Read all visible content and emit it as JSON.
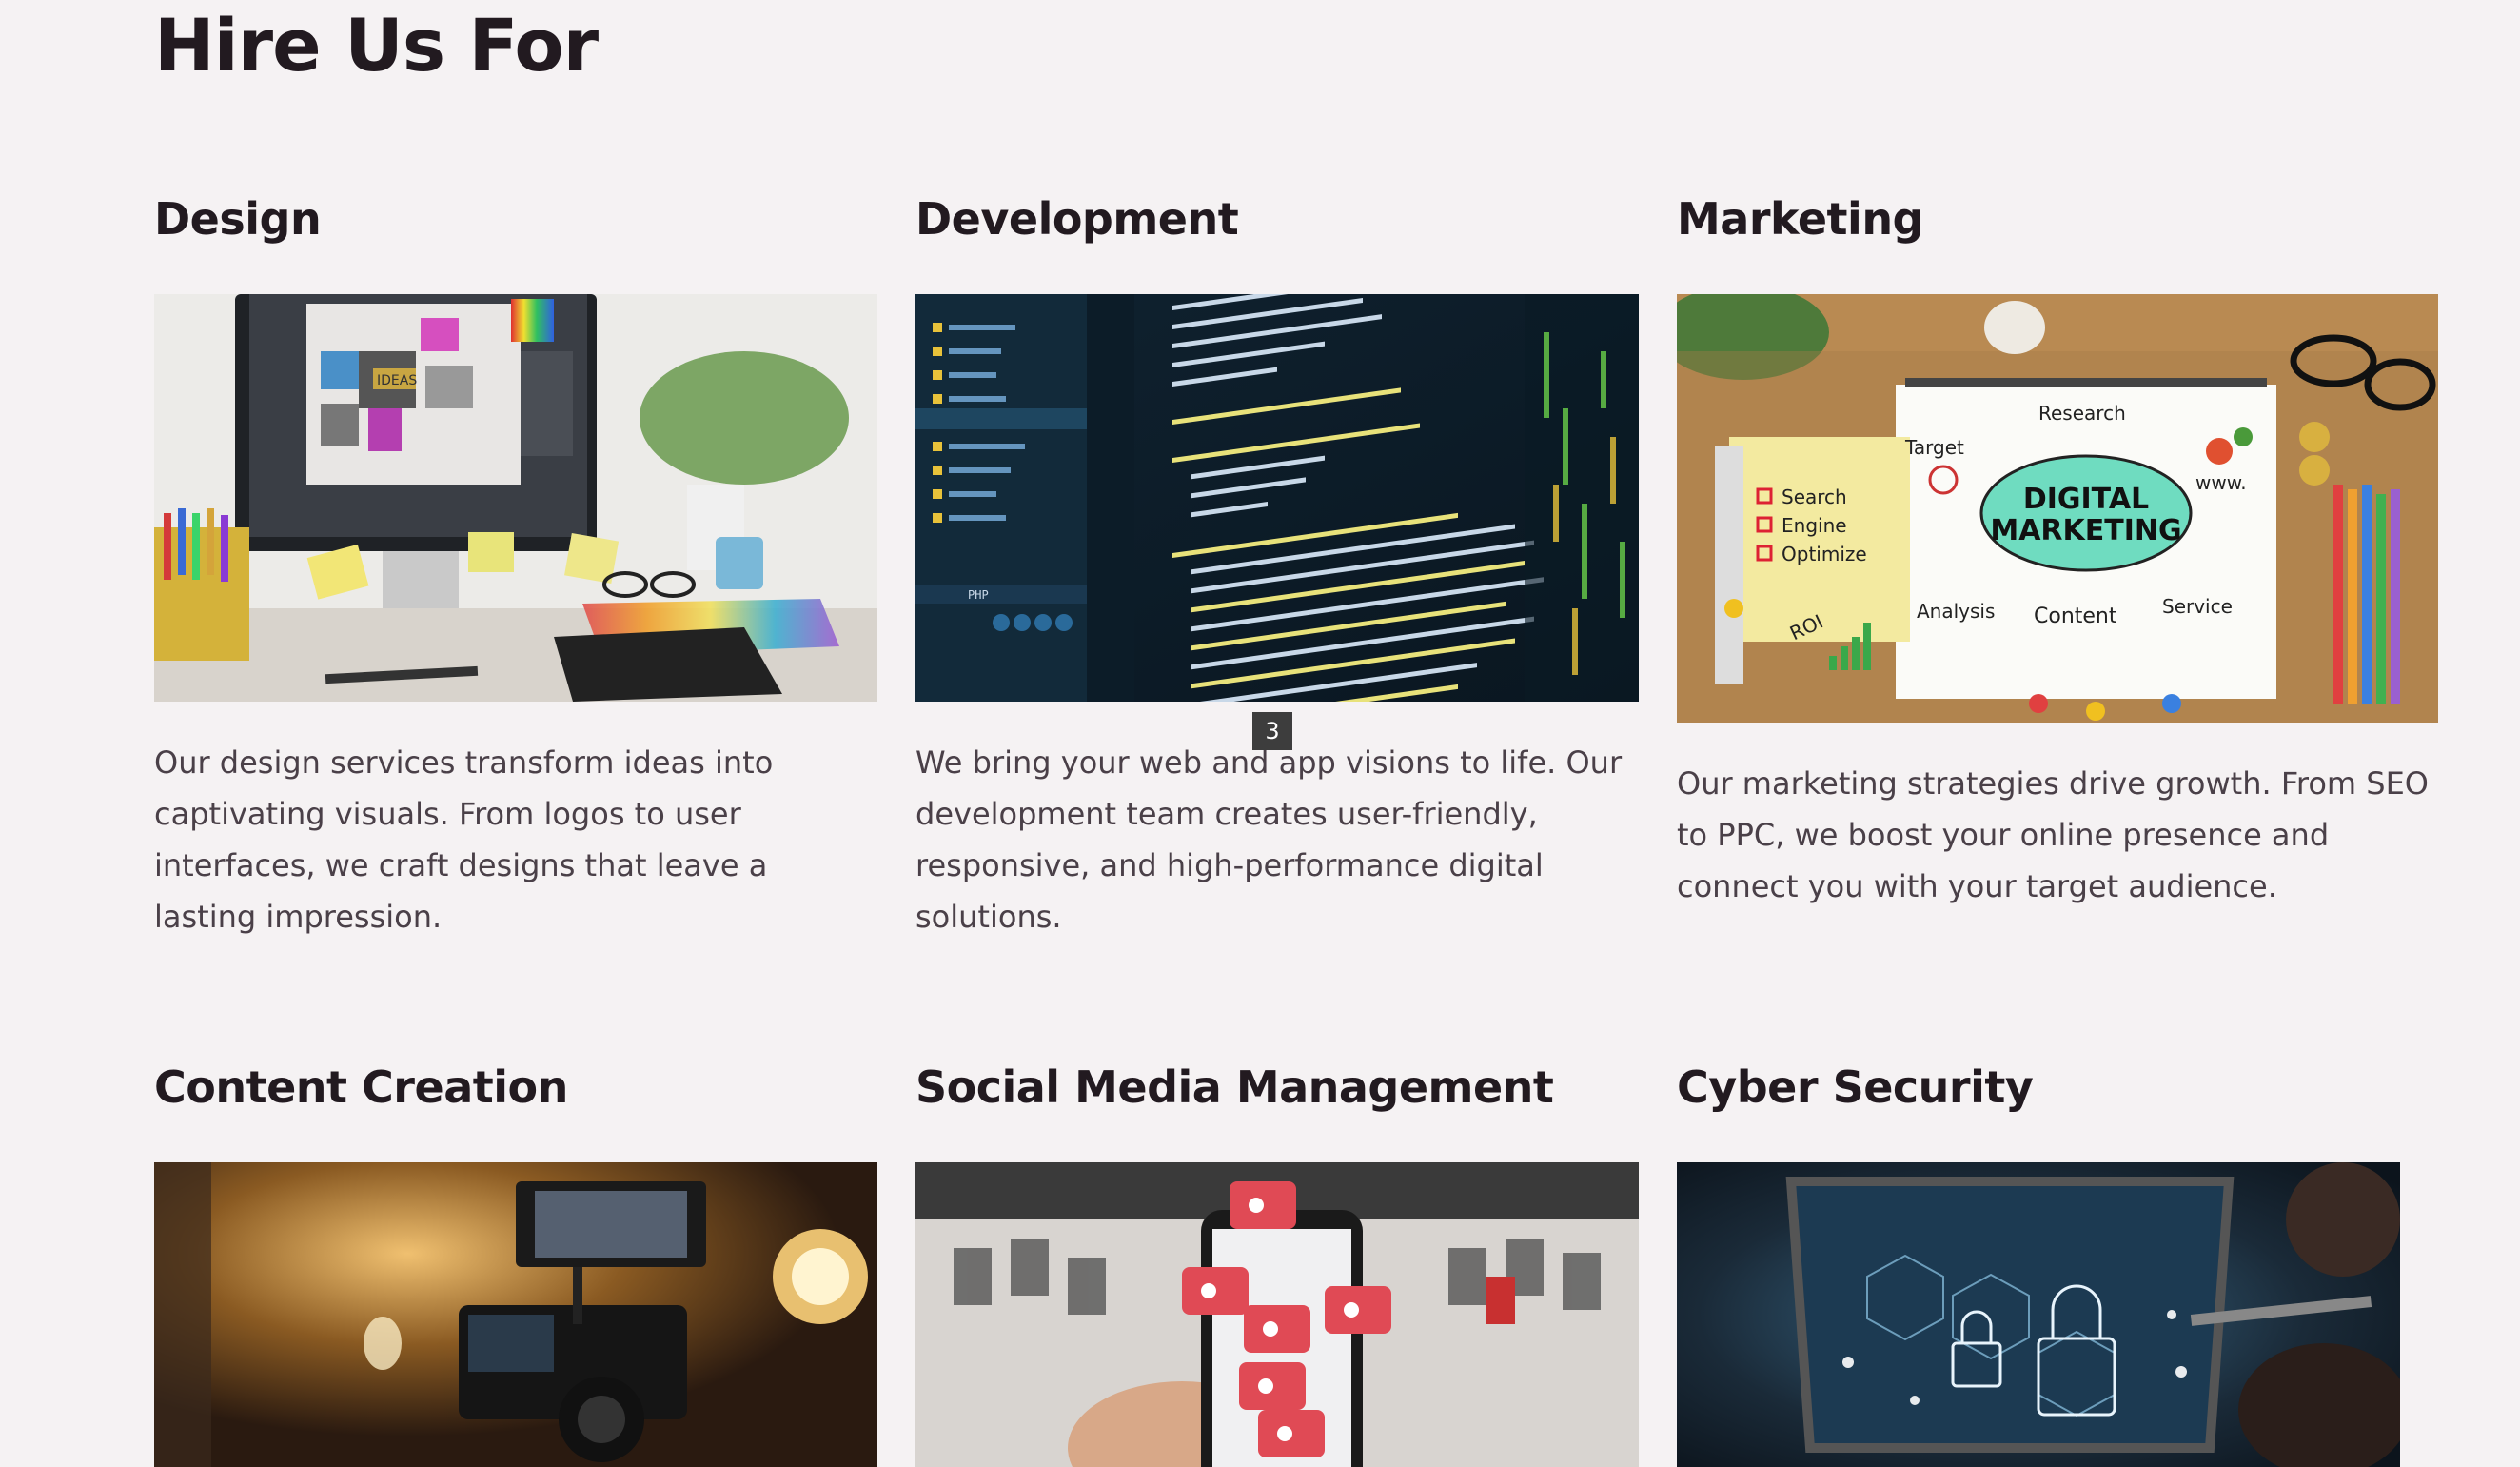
{
  "page": {
    "title": "Hire Us For"
  },
  "services": [
    {
      "title": "Design",
      "description": "Our design services transform ideas into captivating visuals. From logos to user interfaces, we craft designs that leave a lasting impression.",
      "image_label": "IDEAS"
    },
    {
      "title": "Development",
      "description": "We bring your web and app visions to life. Our development team creates user-friendly, responsive, and high-performance digital solutions.",
      "image_label": "PHP"
    },
    {
      "title": "Marketing",
      "description": "Our marketing strategies drive growth. From SEO to PPC, we boost your online presence and connect you with your target audience.",
      "image_label": "DIGITAL MARKETING"
    },
    {
      "title": "Content Creation"
    },
    {
      "title": "Social Media Management"
    },
    {
      "title": "Cyber Security"
    }
  ],
  "marketing_image": {
    "center": [
      "DIGITAL",
      "MARKETING"
    ],
    "research": "Research",
    "target": "Target",
    "www": "www.",
    "analysis": "Analysis",
    "content": "Content",
    "service": "Service",
    "note": [
      "Search",
      "Engine",
      "Optimize"
    ],
    "roi": "ROI"
  },
  "carousel": {
    "badge": "3"
  },
  "colors": {
    "background": "#f5f2f3",
    "heading": "#221a20",
    "body_text": "#4a4048"
  }
}
